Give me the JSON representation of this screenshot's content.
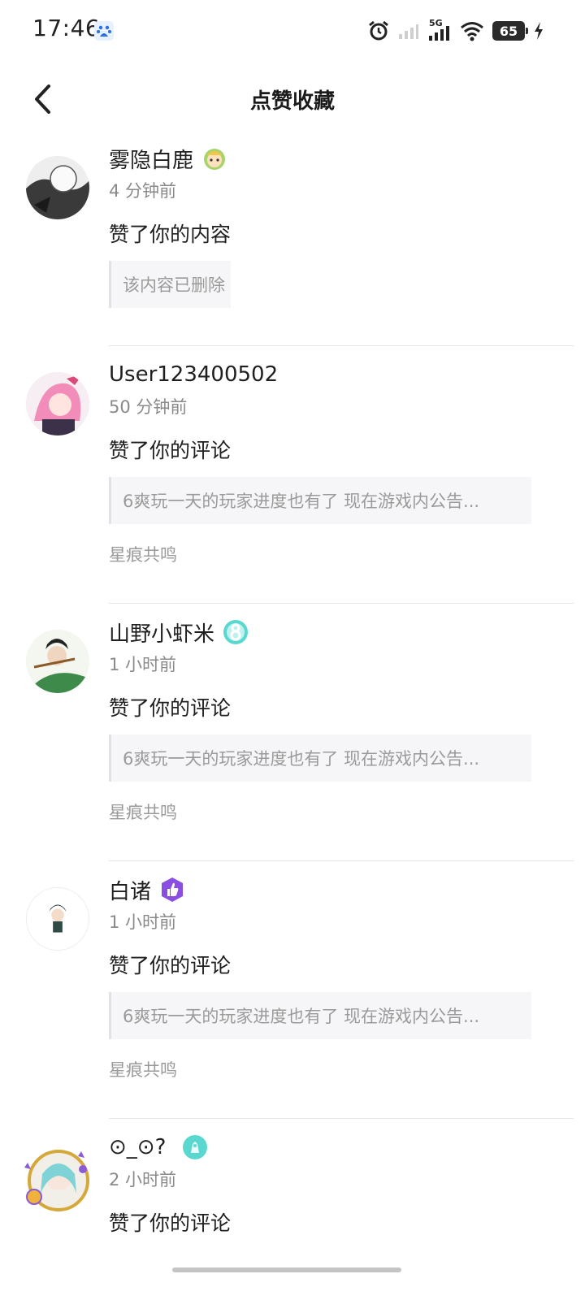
{
  "status": {
    "time": "17:46",
    "battery": "65",
    "network": "5G"
  },
  "header": {
    "title": "点赞收藏"
  },
  "items": [
    {
      "user": "雾隐白鹿",
      "time": "4 分钟前",
      "action": "赞了你的内容",
      "quote": "该内容已删除",
      "game": ""
    },
    {
      "user": "User123400502",
      "time": "50 分钟前",
      "action": "赞了你的评论",
      "quote": "6爽玩一天的玩家进度也有了 现在游戏内公告...",
      "game": "星痕共鸣"
    },
    {
      "user": "山野小虾米",
      "time": "1 小时前",
      "action": "赞了你的评论",
      "quote": "6爽玩一天的玩家进度也有了 现在游戏内公告...",
      "game": "星痕共鸣"
    },
    {
      "user": "白诸",
      "time": "1 小时前",
      "action": "赞了你的评论",
      "quote": "6爽玩一天的玩家进度也有了 现在游戏内公告...",
      "game": "星痕共鸣"
    },
    {
      "user": "⊙_⊙?",
      "time": "2 小时前",
      "action": "赞了你的评论",
      "quote": "",
      "game": ""
    }
  ],
  "icons": {
    "back": "back-arrow-icon",
    "alarm": "alarm-icon",
    "signal": "signal-icon",
    "wifi": "wifi-icon",
    "charging": "charging-bolt-icon"
  },
  "colors": {
    "muted": "#8a8a8a",
    "quote_bg": "#f6f6f8",
    "badge_teal": "#5ad8d0",
    "badge_purple": "#8a4fe0"
  }
}
